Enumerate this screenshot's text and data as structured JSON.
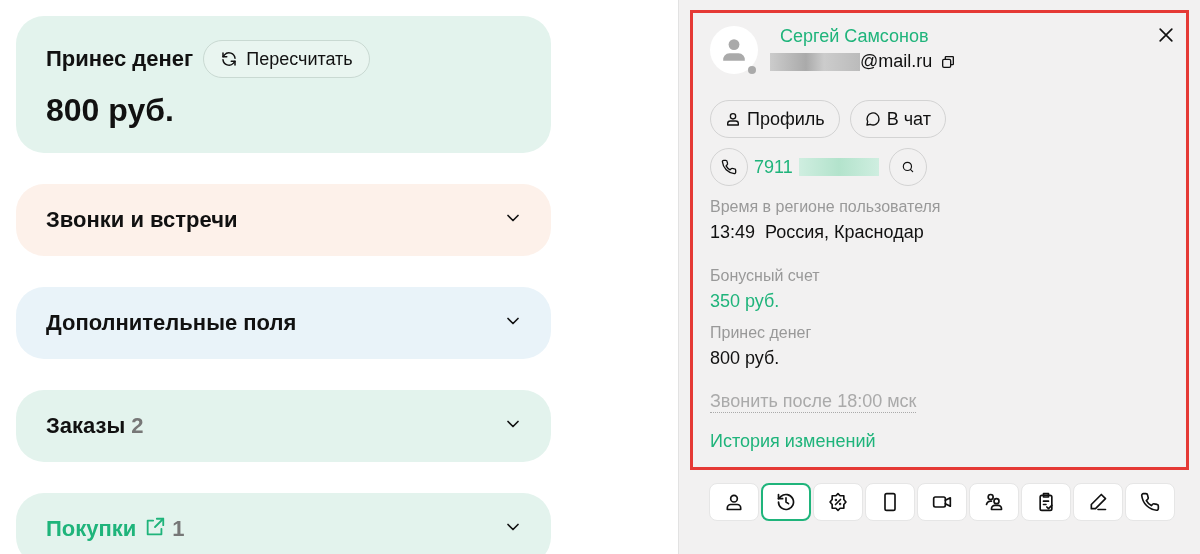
{
  "summary_card": {
    "title": "Принес денег",
    "button": "Пересчитать",
    "amount": "800 руб."
  },
  "sections": [
    {
      "title": "Звонки и встречи",
      "kind": "plain",
      "color": "#fdf1ea",
      "expanded": false
    },
    {
      "title": "Дополнительные поля",
      "kind": "plain",
      "color": "#e9f3f9",
      "expanded": false
    },
    {
      "title": "Заказы",
      "count": "2",
      "kind": "plain",
      "color": "#e3f3ed",
      "expanded": false
    },
    {
      "title": "Покупки",
      "count": "1",
      "kind": "link",
      "color": "#e3f3ed",
      "expanded": false
    }
  ],
  "contact": {
    "name": "Сергей Самсонов",
    "email": "@mail.ru",
    "buttons": [
      "Профиль",
      "В чат"
    ],
    "phone": "7911",
    "fields": [
      {
        "label": "Время в регионе пользователя",
        "time": "13:49",
        "value": "Россия, Краснодар",
        "kind": "time"
      },
      {
        "label": "Бонусный счет",
        "value": "350 руб.",
        "kind": "bonus"
      },
      {
        "label": "Принес денег",
        "value": "800 руб.",
        "kind": "plain"
      }
    ],
    "call_note": "Звонить после 18:00 мск",
    "history_link": "История изменений"
  },
  "toolbar": [
    {
      "selected": false
    },
    {
      "selected": true
    },
    {
      "selected": false
    },
    {
      "selected": false
    },
    {
      "selected": false
    },
    {
      "selected": false
    },
    {
      "selected": false
    },
    {
      "selected": false
    },
    {
      "selected": false
    }
  ]
}
